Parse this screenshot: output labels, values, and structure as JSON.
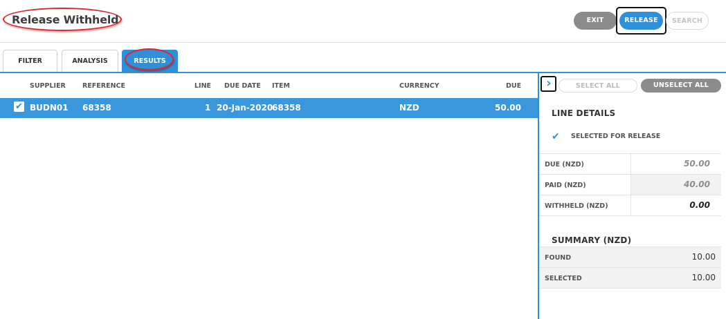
{
  "header": {
    "title": "Release Withheld",
    "buttons": {
      "exit": "EXIT",
      "release": "RELEASE",
      "search": "SEARCH"
    }
  },
  "tabs": [
    {
      "label": "FILTER",
      "active": false
    },
    {
      "label": "ANALYSIS",
      "active": false
    },
    {
      "label": "RESULTS",
      "active": true
    }
  ],
  "results": {
    "columns": {
      "supplier": "SUPPLIER",
      "reference": "REFERENCE",
      "line": "LINE",
      "due_date": "DUE DATE",
      "item": "ITEM",
      "currency": "CURRENCY",
      "due": "DUE"
    },
    "rows": [
      {
        "selected": true,
        "supplier": "BUDN01",
        "reference": "68358",
        "line": "1",
        "due_date": "20-Jan-2020",
        "item": "68358",
        "currency": "NZD",
        "due": "50.00"
      }
    ]
  },
  "panel": {
    "select_all": "SELECT ALL",
    "unselect_all": "UNSELECT ALL",
    "line_details_title": "LINE DETAILS",
    "selected_for_release": "SELECTED FOR RELEASE",
    "details": [
      {
        "label": "DUE (NZD)",
        "value": "50.00"
      },
      {
        "label": "PAID (NZD)",
        "value": "40.00"
      },
      {
        "label": "WITHHELD (NZD)",
        "value": "0.00"
      }
    ],
    "summary_title": "SUMMARY (NZD)",
    "summary": [
      {
        "label": "FOUND",
        "value": "10.00"
      },
      {
        "label": "SELECTED",
        "value": "10.00"
      }
    ]
  },
  "colors": {
    "accent": "#2f8fd8",
    "highlight_ring": "#d9282f",
    "button_grey": "#8c8c8c"
  },
  "icons": {
    "check": "checkmark-icon",
    "collapse": "chevron-right-icon"
  }
}
